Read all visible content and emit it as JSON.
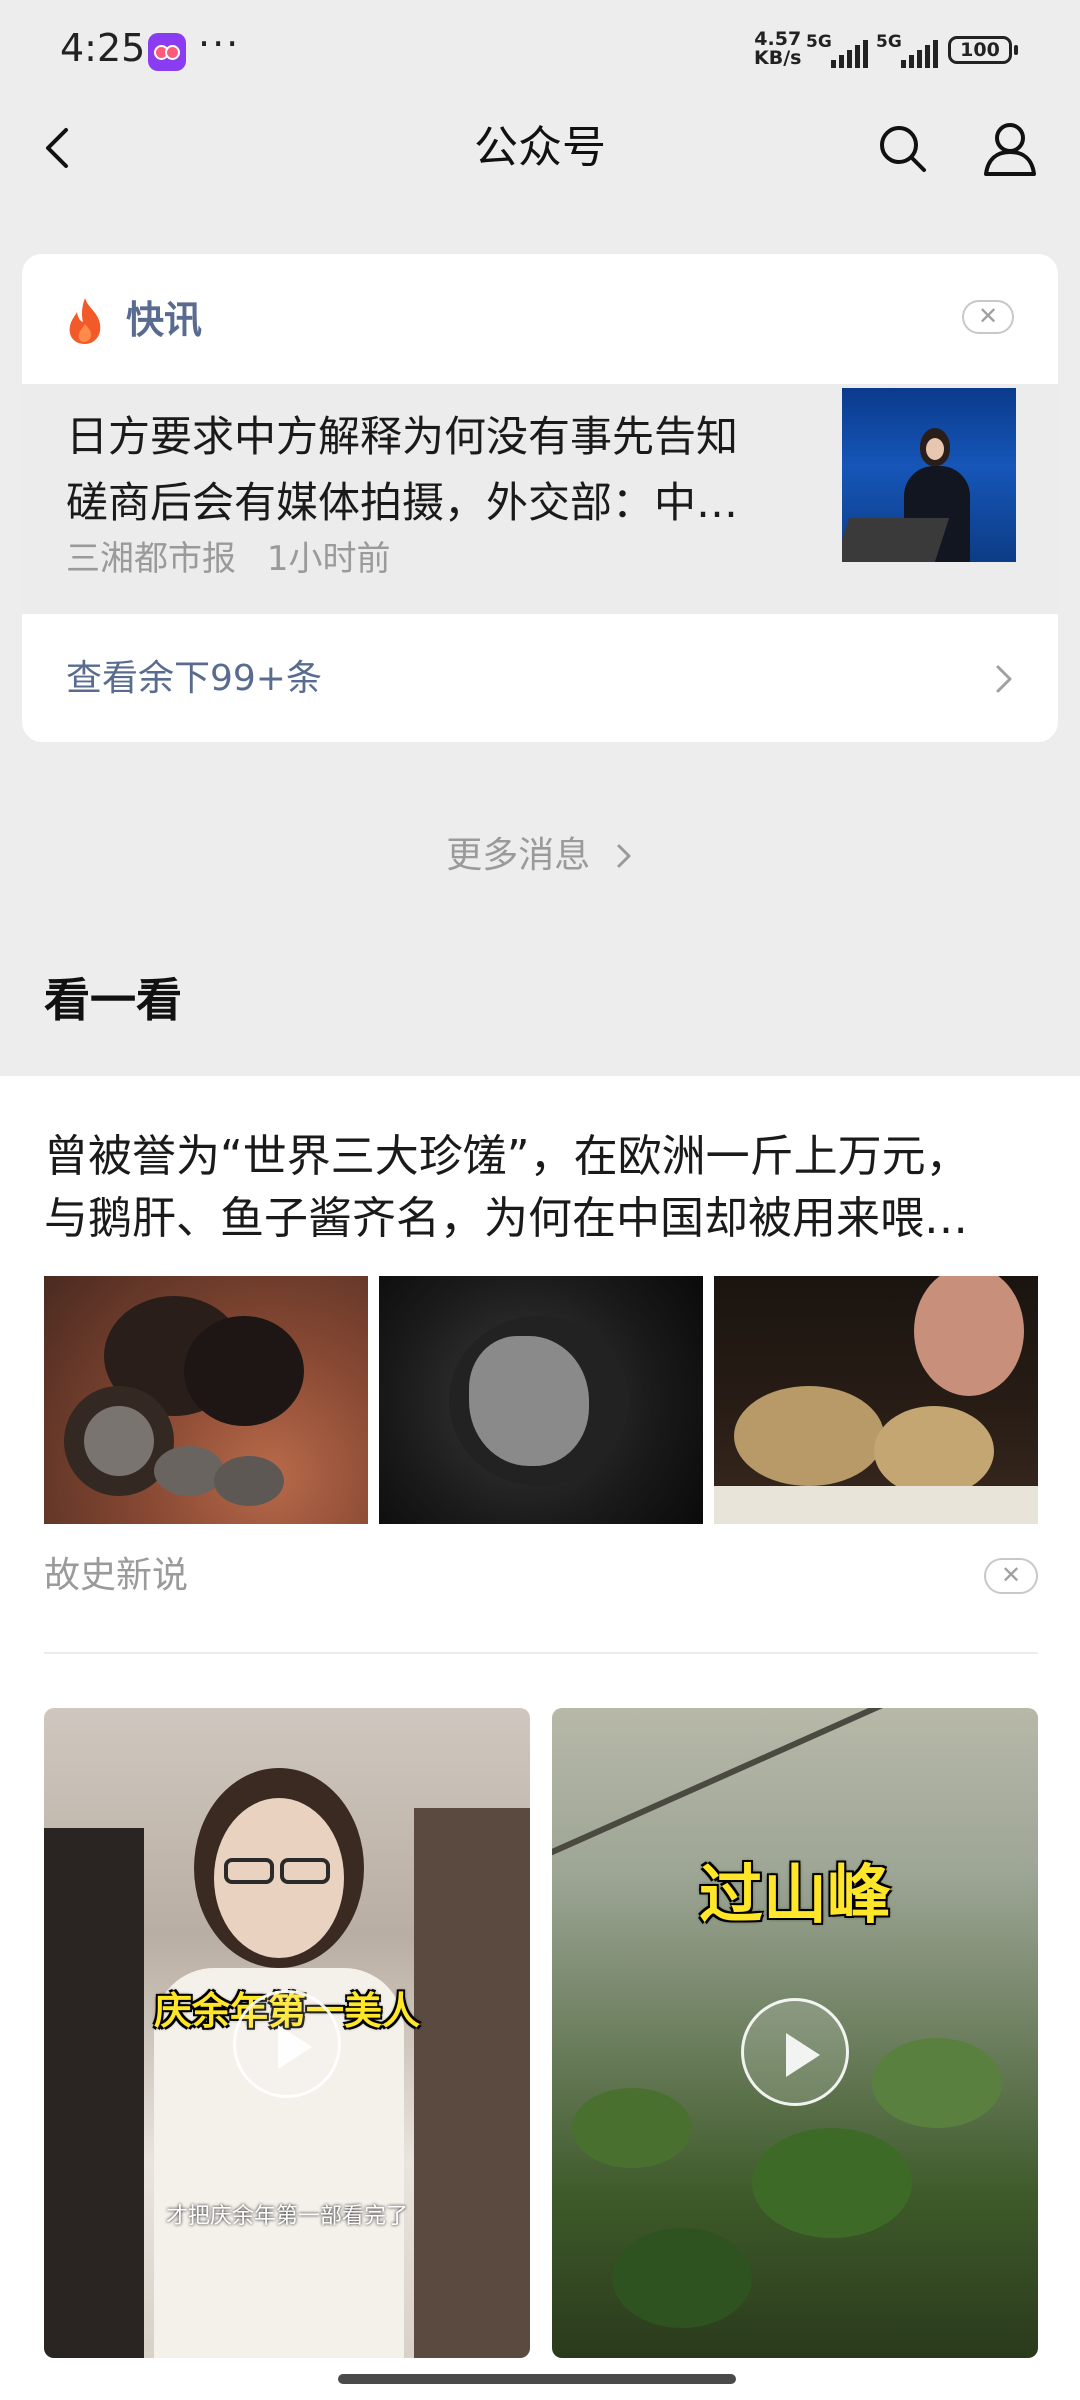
{
  "status_bar": {
    "time": "4:25",
    "app_icon": "cat-app-icon",
    "more": "···",
    "speed_value": "4.57",
    "speed_unit": "KB/s",
    "sim1": "5G",
    "sim2": "5G",
    "battery": "100"
  },
  "nav": {
    "title": "公众号",
    "back_icon": "chevron-left-icon",
    "search_icon": "search-icon",
    "profile_icon": "person-icon"
  },
  "news_card": {
    "tag": "快讯",
    "tag_color": "#596c90",
    "fire_color": "#f25a2a",
    "close": "✕",
    "item": {
      "title_line1": "日方要求中方解释为何没有事先告知",
      "title_line2": "磋商后会有媒体拍摄，外交部：中…",
      "source": "三湘都市报",
      "time": "1小时前"
    },
    "more": "查看余下99+条"
  },
  "more_messages": "更多消息",
  "section_title": "看一看",
  "article": {
    "title_line1": "曾被誉为“世界三大珍馐”，在欧洲一斤上万元，",
    "title_line2": "与鹅肝、鱼子酱齐名，为何在中国却被用来喂…",
    "source": "故史新说",
    "close": "✕"
  },
  "videos": [
    {
      "caption": "庆余年第一美人",
      "subcaption": "才把庆余年第一部看完了"
    },
    {
      "caption": "过山峰"
    }
  ]
}
